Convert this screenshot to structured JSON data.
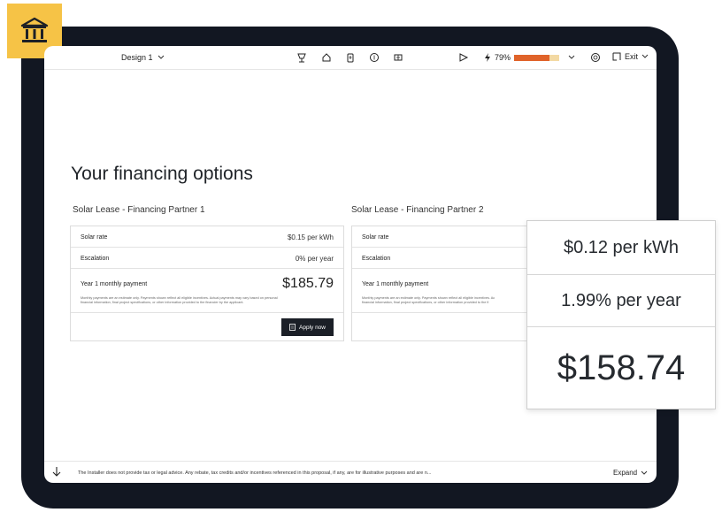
{
  "header": {
    "design_label": "Design 1",
    "battery_percent": "79%",
    "battery_level": 0.79,
    "exit_label": "Exit"
  },
  "main": {
    "title": "Your financing options"
  },
  "cards": [
    {
      "title": "Solar Lease - Financing Partner 1",
      "solar_rate_label": "Solar rate",
      "solar_rate_value": "$0.15 per kWh",
      "escalation_label": "Escalation",
      "escalation_value": "0% per year",
      "payment_label": "Year 1 monthly payment",
      "payment_value": "$185.79",
      "disclaimer_line1": "Monthly payments are an estimate only. Payments shown reflect all eligible incentives. Actual payments may vary based on personal",
      "disclaimer_line2": "financial information, final project specifications, or other information provided to the financier by the applicant.",
      "apply_label": "Apply now"
    },
    {
      "title": "Solar Lease - Financing Partner 2",
      "solar_rate_label": "Solar rate",
      "escalation_label": "Escalation",
      "payment_label": "Year 1 monthly payment",
      "disclaimer_line1": "Monthly payments are an estimate only. Payments shown reflect all eligible incentives. Ac",
      "disclaimer_line2": "financial information, final project specifications, or other information provided to the fi"
    }
  ],
  "zoom": {
    "solar_rate": "$0.12 per kWh",
    "escalation": "1.99% per year",
    "payment": "$158.74"
  },
  "footer": {
    "disclaimer": "The Installer does not provide tax or legal advice. Any rebate, tax credits and/or incentives referenced in this proposal, if any, are for illustrative purposes and are n...",
    "expand_label": "Expand"
  },
  "colors": {
    "badge": "#f6c346",
    "device_frame": "#121722",
    "battery_fill": "#e0632a",
    "battery_track": "#f3d9a3",
    "apply_button": "#1b1f27"
  },
  "icons": [
    "bank-icon",
    "chevron-down-icon",
    "solar-panel-icon",
    "home-icon",
    "battery-icon",
    "dollar-icon",
    "incentive-icon",
    "send-icon",
    "lightning-icon",
    "support-icon",
    "exit-icon",
    "document-icon",
    "arrow-down-icon"
  ]
}
